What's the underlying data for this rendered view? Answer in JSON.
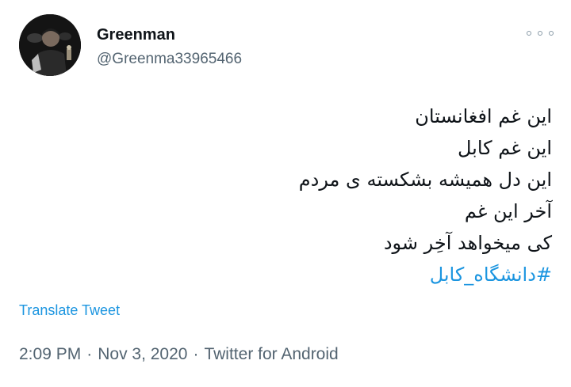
{
  "user": {
    "display_name": "Greenman",
    "handle": "@Greenma33965466"
  },
  "tweet": {
    "lines": [
      "این غم افغانستان",
      "این غم کابل",
      "این دل همیشه بشکسته ی مردم",
      "آخر این غم",
      " کی میخواهد آخِر شود"
    ],
    "hashtag": "#دانشگاه_کابل"
  },
  "actions": {
    "translate_label": "Translate Tweet",
    "more_icon": "more-dots-icon"
  },
  "meta": {
    "time": "2:09 PM",
    "separator": "·",
    "date": "Nov 3, 2020",
    "source": "Twitter for Android"
  },
  "colors": {
    "text": "#0f1419",
    "secondary": "#536471",
    "link": "#1b95e0"
  }
}
